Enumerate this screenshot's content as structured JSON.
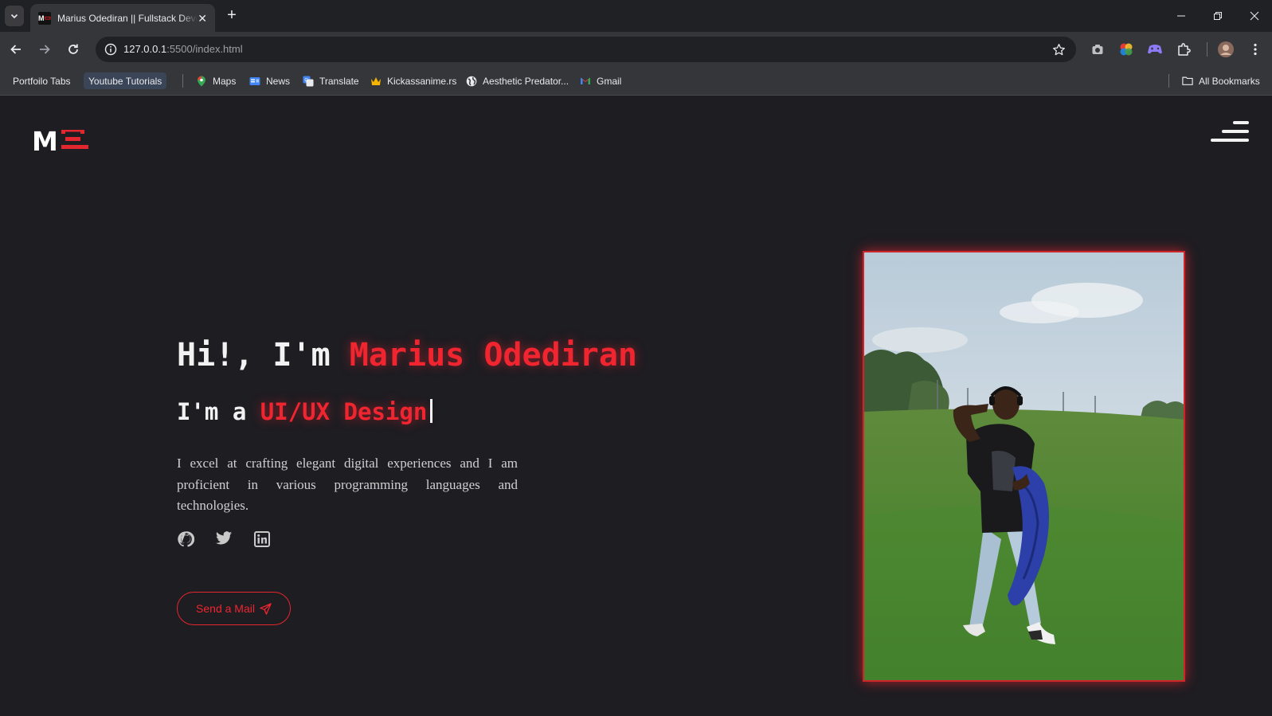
{
  "browser": {
    "tab_title": "Marius Odediran || Fullstack Developer",
    "favicon_text": "M",
    "url_host": "127.0.0.1",
    "url_path": ":5500/index.html",
    "bookmarks": [
      {
        "label": "Portfoilo Tabs",
        "icon": "none"
      },
      {
        "label": "Youtube Tutorials",
        "icon": "none"
      },
      {
        "label": "Maps",
        "icon": "maps-icon"
      },
      {
        "label": "News",
        "icon": "news-icon"
      },
      {
        "label": "Translate",
        "icon": "translate-icon"
      },
      {
        "label": "Kickassanime.rs",
        "icon": "crown-icon"
      },
      {
        "label": "Aesthetic Predator...",
        "icon": "globe-icon"
      },
      {
        "label": "Gmail",
        "icon": "gmail-icon"
      }
    ],
    "all_bookmarks_label": "All Bookmarks"
  },
  "page": {
    "logo_text": "M",
    "hero": {
      "greeting": "Hi!, I'm",
      "name": "Marius Odediran",
      "role_prefix": "I'm a",
      "role": "UI/UX Design",
      "description": "I excel at crafting elegant digital experiences and I am proficient in various programming languages and technologies.",
      "cta_label": "Send a Mail"
    },
    "socials": [
      "github-icon",
      "twitter-icon",
      "linkedin-icon"
    ]
  },
  "colors": {
    "accent": "#f0252f",
    "background": "#1e1d22",
    "chrome": "#35363a"
  }
}
